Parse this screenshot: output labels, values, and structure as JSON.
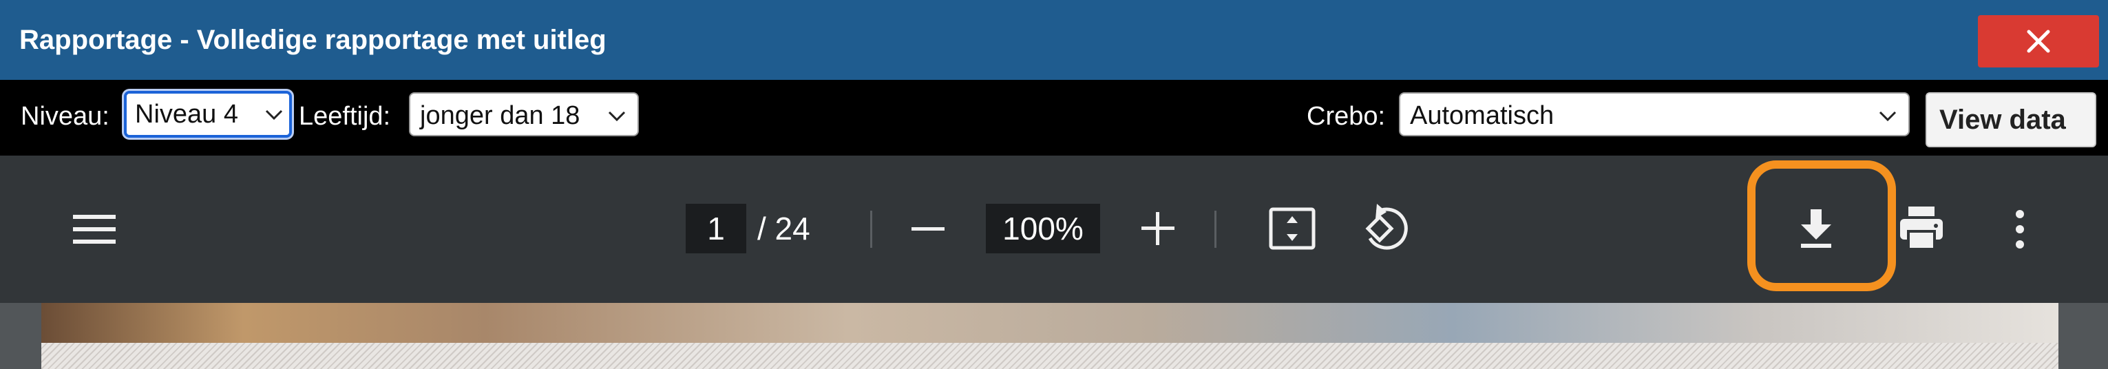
{
  "window": {
    "title": "Rapportage - Volledige rapportage met uitleg",
    "close_icon": "close-icon"
  },
  "filters": {
    "niveau_label": "Niveau:",
    "niveau_value": "Niveau 4",
    "leeftijd_label": "Leeftijd:",
    "leeftijd_value": "jonger dan 18",
    "crebo_label": "Crebo:",
    "crebo_value": "Automatisch",
    "view_data_label": "View data"
  },
  "pdf_toolbar": {
    "current_page": "1",
    "total_pages": "/ 24",
    "zoom": "100%",
    "icons": [
      "menu-icon",
      "zoom-out-icon",
      "zoom-in-icon",
      "fit-page-icon",
      "rotate-icon",
      "download-icon",
      "print-icon",
      "more-options-icon"
    ],
    "highlight_color": "#f5911f"
  },
  "colors": {
    "title_bar": "#1f5c8f",
    "close_button": "#d93a32",
    "filter_bar": "#000000",
    "pdf_toolbar": "#323639"
  }
}
